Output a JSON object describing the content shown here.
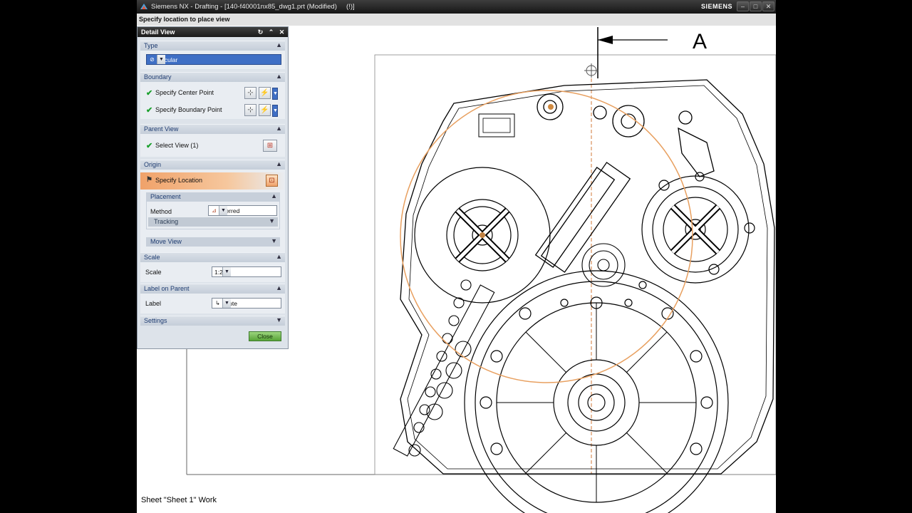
{
  "window": {
    "title": "Siemens NX - Drafting - [140-f40001nx85_dwg1.prt (Modified)     (!)]",
    "brand": "SIEMENS",
    "buttons": [
      "minimize",
      "maximize",
      "close"
    ]
  },
  "cue_line": "Specify location to place view",
  "status_line": "Sheet \"Sheet 1\" Work",
  "section_label": "A",
  "view_toolbar": {
    "icons": [
      "nx-roles-icon",
      "gear-icon",
      "grid-icon",
      "menu-list-icon"
    ]
  },
  "dialog": {
    "title": "Detail View",
    "title_buttons": [
      "reset-icon",
      "collapse-icon",
      "close-icon"
    ],
    "type": {
      "header": "Type",
      "value": "Circular"
    },
    "boundary": {
      "header": "Boundary",
      "center_point": "Specify Center Point",
      "boundary_point": "Specify Boundary Point"
    },
    "parent_view": {
      "header": "Parent View",
      "select": "Select View (1)"
    },
    "origin": {
      "header": "Origin",
      "specify_location": "Specify Location",
      "placement": {
        "header": "Placement",
        "method_label": "Method",
        "method_value": "Inferred",
        "tracking": "Tracking"
      },
      "move_view": "Move View"
    },
    "scale": {
      "header": "Scale",
      "label": "Scale",
      "value": "1:2"
    },
    "label_on_parent": {
      "header": "Label on Parent",
      "label": "Label",
      "value": "Note"
    },
    "settings": {
      "header": "Settings"
    },
    "close_label": "Close"
  },
  "colors": {
    "accent_orange": "#e8a060",
    "check_green": "#1aa02c",
    "selection_blue": "#3f6fc5",
    "close_green": "#58a438"
  }
}
